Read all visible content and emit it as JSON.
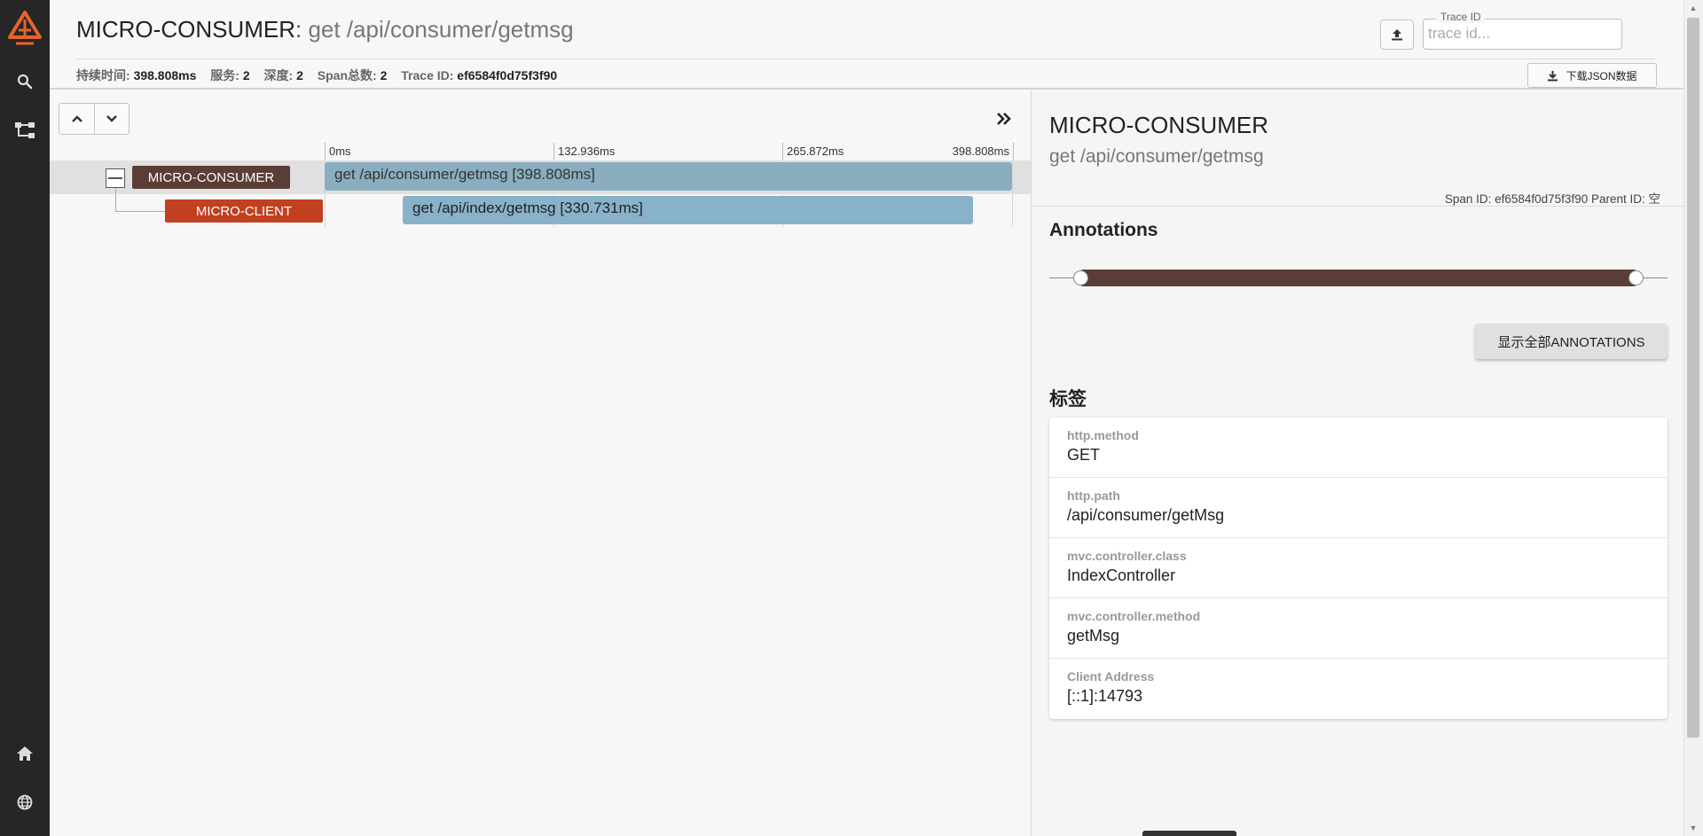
{
  "header": {
    "service_name": "MICRO-CONSUMER",
    "separator": ": ",
    "operation": "get /api/consumer/getmsg",
    "stats": [
      {
        "label": "持续时间:",
        "value": "398.808ms"
      },
      {
        "label": "服务:",
        "value": "2"
      },
      {
        "label": "深度:",
        "value": "2"
      },
      {
        "label": "Span总数:",
        "value": "2"
      },
      {
        "label": "Trace ID:",
        "value": "ef6584f0d75f3f90"
      }
    ],
    "trace_id_label": "Trace ID",
    "trace_id_placeholder": "trace id...",
    "download_label": "下载JSON数据"
  },
  "timeline": {
    "ticks": [
      "0ms",
      "132.936ms",
      "265.872ms",
      "398.808ms"
    ],
    "spans": [
      {
        "service": "MICRO-CONSUMER",
        "label": "get /api/consumer/getmsg [398.808ms]",
        "color": "#5a3e36"
      },
      {
        "service": "MICRO-CLIENT",
        "label": "get /api/index/getmsg [330.731ms]",
        "color": "#c0401f"
      }
    ]
  },
  "detail": {
    "service": "MICRO-CONSUMER",
    "operation": "get /api/consumer/getmsg",
    "ids_text": "Span ID: ef6584f0d75f3f90   Parent ID: 空",
    "annotations_title": "Annotations",
    "show_all_label": "显示全部ANNOTATIONS",
    "tags_title": "标签",
    "tags": [
      {
        "key": "http.method",
        "value": "GET"
      },
      {
        "key": "http.path",
        "value": "/api/consumer/getMsg"
      },
      {
        "key": "mvc.controller.class",
        "value": "IndexController"
      },
      {
        "key": "mvc.controller.method",
        "value": "getMsg"
      },
      {
        "key": "Client Address",
        "value": "[::1]:14793"
      }
    ]
  },
  "icons": {
    "logo": "zipkin-logo-icon",
    "search": "search-icon",
    "dependencies": "dependency-graph-icon",
    "home": "home-icon",
    "language": "globe-icon"
  },
  "colors": {
    "sidebar": "#262626",
    "logo": "#e8632b",
    "consumer": "#5a3e36",
    "client": "#c0401f",
    "span_bar": "#8aaebf"
  }
}
